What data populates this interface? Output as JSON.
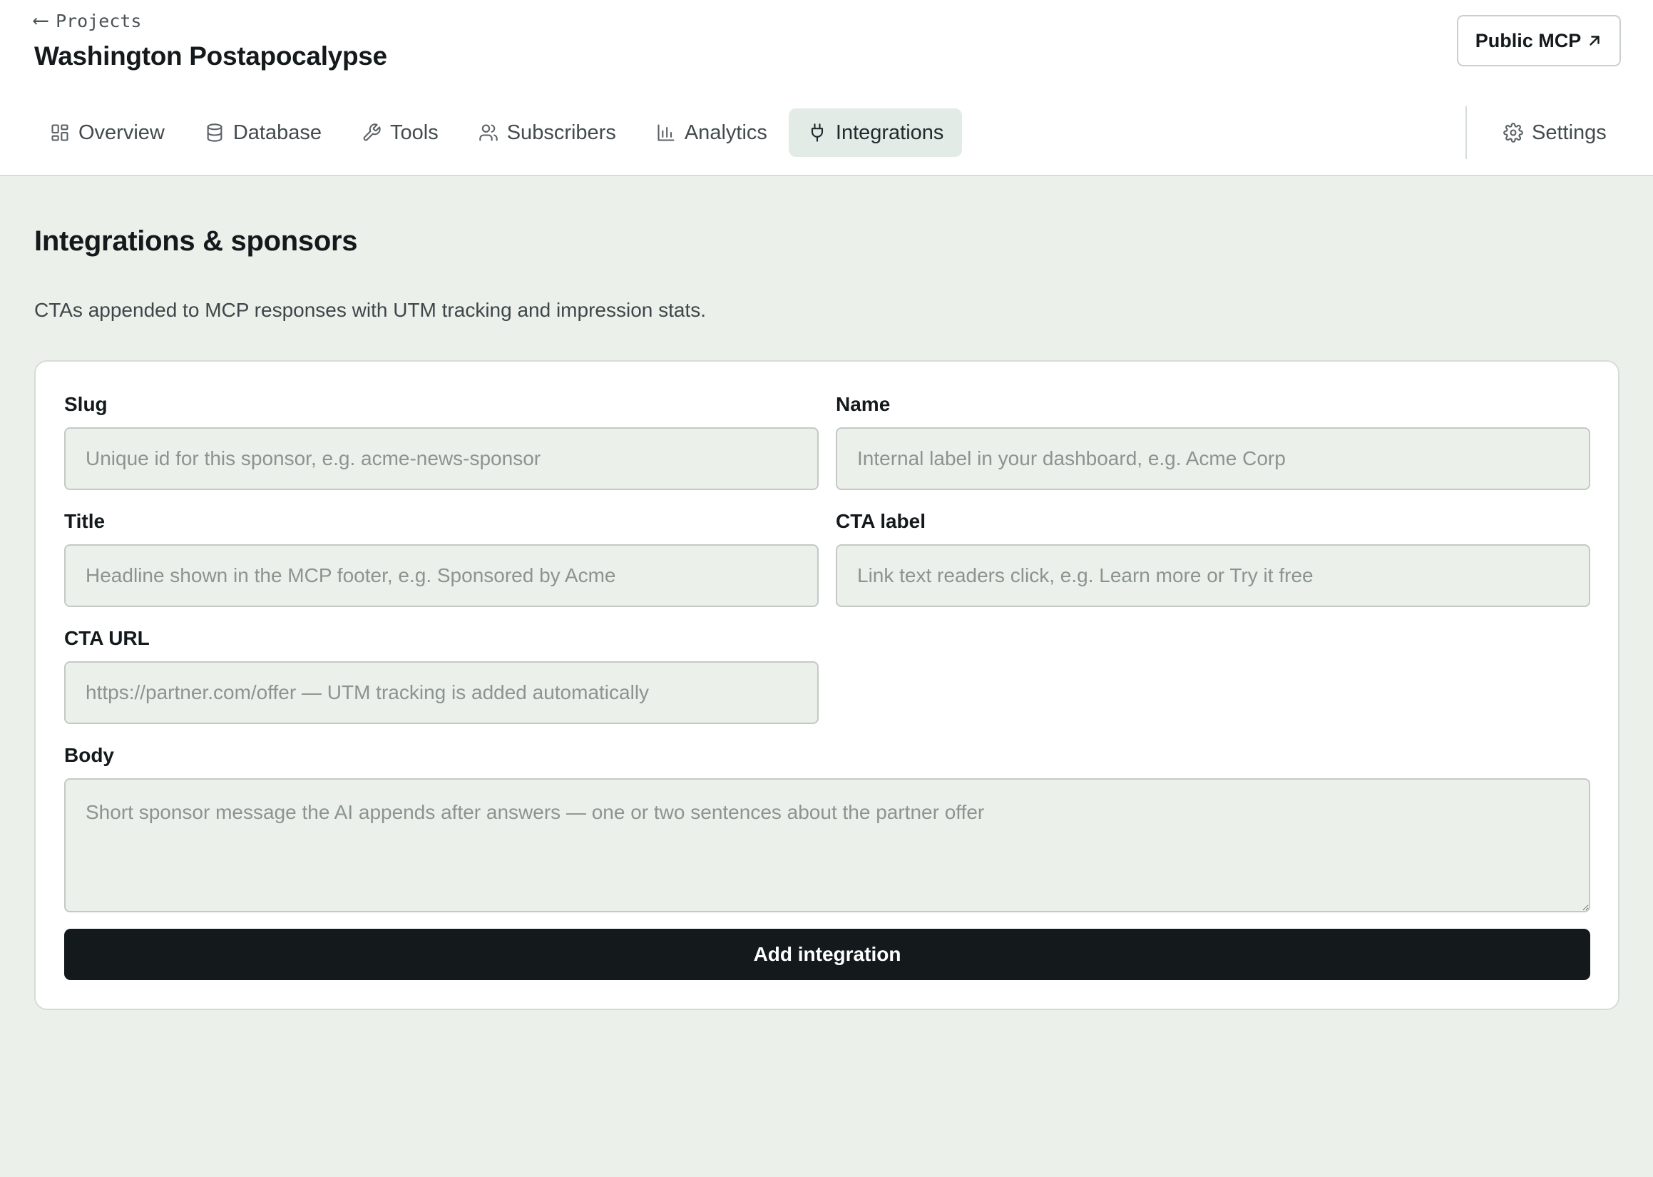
{
  "header": {
    "back_label": "Projects",
    "project_title": "Washington Postapocalypse",
    "public_button_label": "Public MCP"
  },
  "tabs": [
    {
      "label": "Overview",
      "icon": "grid-icon"
    },
    {
      "label": "Database",
      "icon": "database-icon"
    },
    {
      "label": "Tools",
      "icon": "wrench-icon"
    },
    {
      "label": "Subscribers",
      "icon": "users-icon"
    },
    {
      "label": "Analytics",
      "icon": "bar-chart-icon"
    },
    {
      "label": "Integrations",
      "icon": "plug-icon",
      "active": true
    }
  ],
  "settings_label": "Settings",
  "page": {
    "title": "Integrations & sponsors",
    "description": "CTAs appended to MCP responses with UTM tracking and impression stats."
  },
  "form": {
    "slug": {
      "label": "Slug",
      "value": "",
      "placeholder": "Unique id for this sponsor, e.g. acme-news-sponsor"
    },
    "name": {
      "label": "Name",
      "value": "",
      "placeholder": "Internal label in your dashboard, e.g. Acme Corp"
    },
    "title": {
      "label": "Title",
      "value": "",
      "placeholder": "Headline shown in the MCP footer, e.g. Sponsored by Acme"
    },
    "cta_label": {
      "label": "CTA label",
      "value": "",
      "placeholder": "Link text readers click, e.g. Learn more or Try it free"
    },
    "cta_url": {
      "label": "CTA URL",
      "value": "",
      "placeholder": "https://partner.com/offer — UTM tracking is added automatically"
    },
    "body": {
      "label": "Body",
      "value": "",
      "placeholder": "Short sponsor message the AI appends after answers — one or two sentences about the partner offer"
    },
    "submit_label": "Add integration"
  },
  "colors": {
    "page_bg": "#ecf0eb",
    "active_tab_bg": "#e2ebe6",
    "primary_button_bg": "#141a1c"
  }
}
